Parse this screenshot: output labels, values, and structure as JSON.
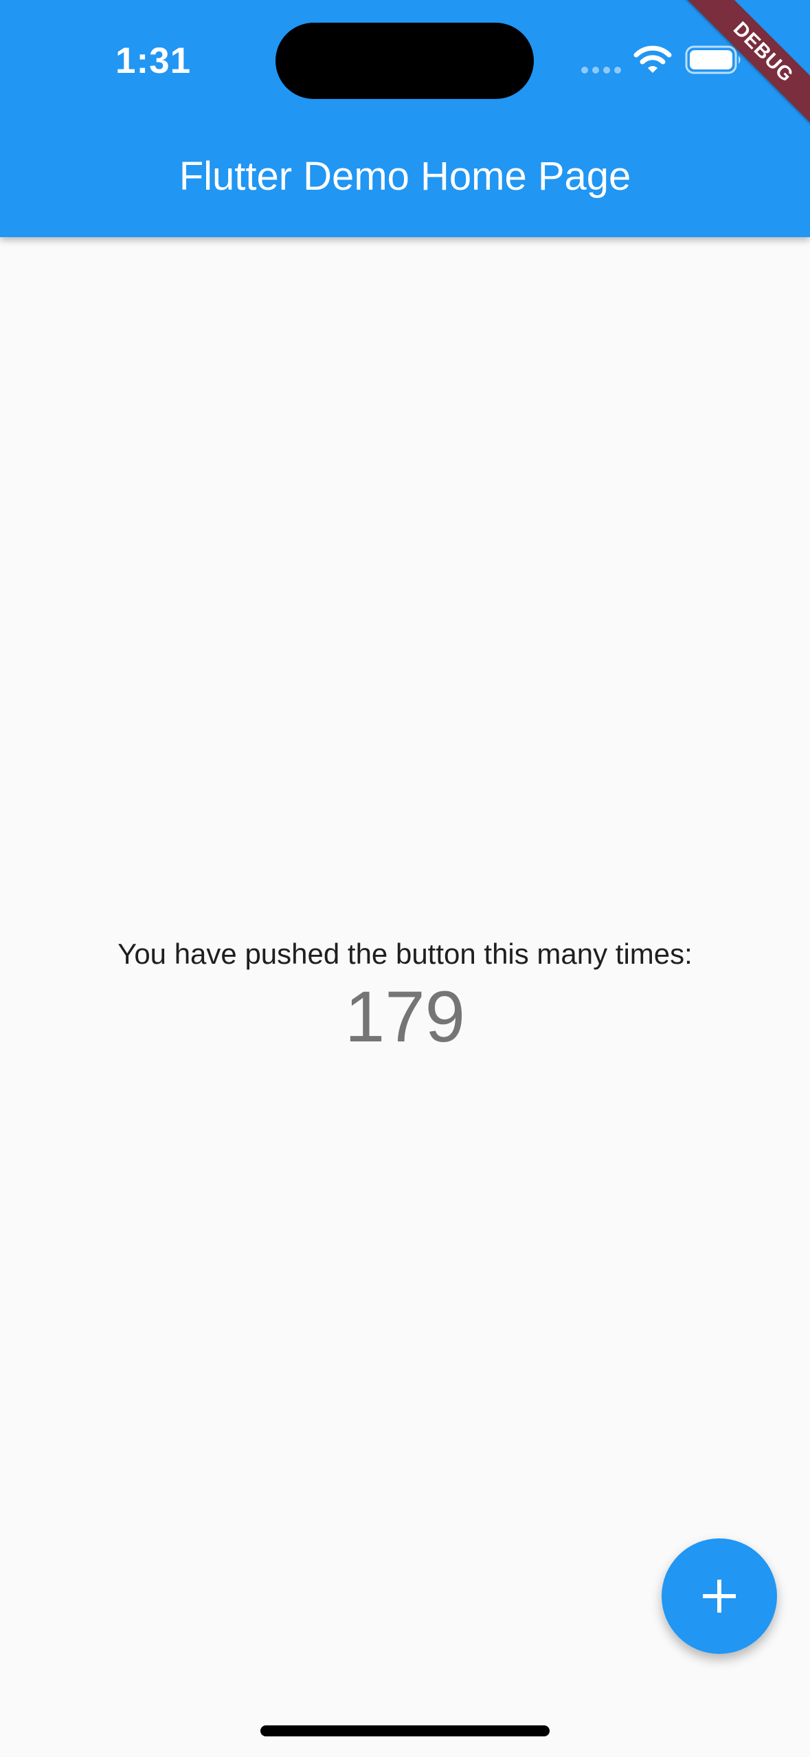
{
  "status_bar": {
    "time": "1:31",
    "icons": [
      "signal-dots-icon",
      "wifi-icon",
      "battery-icon"
    ]
  },
  "app_bar": {
    "title": "Flutter Demo Home Page",
    "background_color": "#2196f3"
  },
  "debug_banner": {
    "label": "DEBUG",
    "color": "#7a2e3e"
  },
  "main": {
    "caption": "You have pushed the button this many times:",
    "counter": "179"
  },
  "fab": {
    "icon": "plus-icon",
    "color": "#2196f3"
  }
}
